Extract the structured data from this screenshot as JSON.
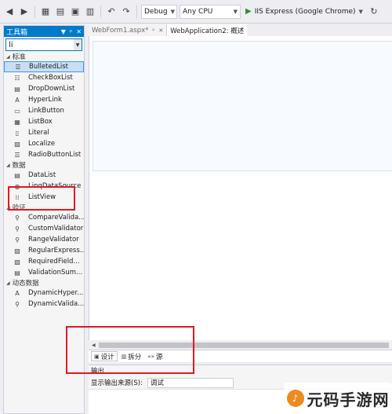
{
  "toolbar": {
    "config": "Debug",
    "platform": "Any CPU",
    "run_label": "IIS Express (Google Chrome)"
  },
  "toolbox": {
    "title": "工具箱",
    "search_value": "li",
    "categories": [
      {
        "name": "标准",
        "items": [
          "BulletedList",
          "CheckBoxList",
          "DropDownList",
          "HyperLink",
          "LinkButton",
          "ListBox",
          "Literal",
          "Localize",
          "RadioButtonList"
        ]
      },
      {
        "name": "数据",
        "items": [
          "DataList",
          "LinqDataSource",
          "ListView"
        ]
      },
      {
        "name": "验证",
        "items": [
          "CompareValida...",
          "CustomValidator",
          "RangeValidator",
          "RegularExpress...",
          "RequiredField...",
          "ValidationSum..."
        ]
      },
      {
        "name": "动态数据",
        "items": [
          "DynamicHyper...",
          "DynamicValida..."
        ]
      }
    ]
  },
  "tabs": [
    {
      "label": "WebForm1.aspx*",
      "active": false
    },
    {
      "label": "WebApplication2: 概述",
      "active": true
    }
  ],
  "viewbar": {
    "design": "设计",
    "split": "拆分",
    "source": "源"
  },
  "output": {
    "title": "输出",
    "source_label": "显示输出来源(S):",
    "source_value": "调试"
  },
  "watermark": "元码手游网",
  "colors": {
    "accent": "#007acc",
    "annotation": "#e8171f"
  }
}
